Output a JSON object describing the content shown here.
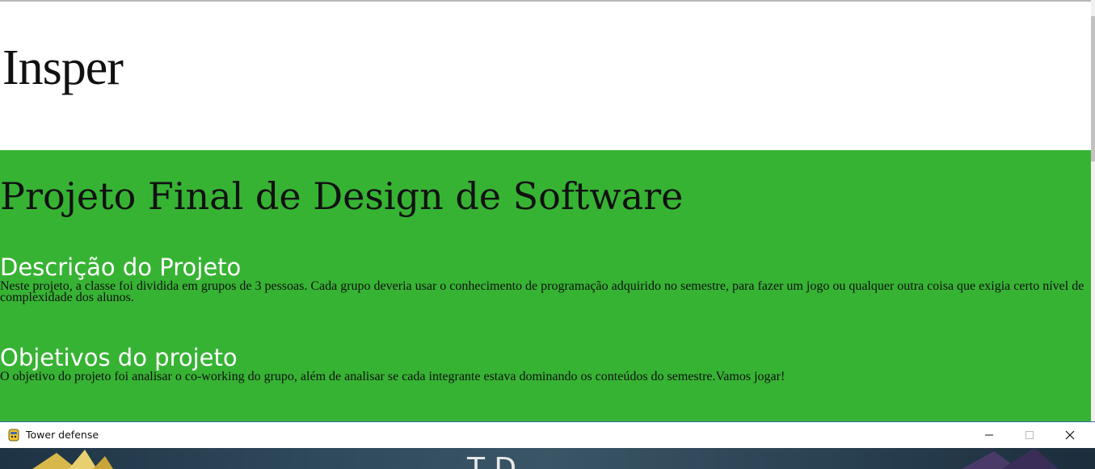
{
  "logo": {
    "text": "Insper"
  },
  "header": {
    "title": "Projeto Final de Design de Software"
  },
  "description": {
    "heading": "Descrição do Projeto",
    "text": "Neste projeto, a classe foi dividida em grupos de 3 pessoas. Cada grupo deveria usar o conhecimento de programação adquirido no semestre, para fazer um jogo ou qualquer outra coisa que exigia certo nível de complexidade dos alunos."
  },
  "objectives": {
    "heading": "Objetivos do projeto",
    "text": "O objetivo do projeto foi analisar o co-working do grupo, além de analisar se cada integrante estava dominando os conteúdos do semestre.Vamos jogar!"
  },
  "window": {
    "title": "Tower defense",
    "icon": "python-snake-icon",
    "controls": [
      "minimize-icon",
      "maximize-icon",
      "close-icon"
    ]
  },
  "game_canvas": {
    "visible_text": "T    D"
  },
  "colors": {
    "green_section": "#37b334",
    "heading_text": "#ffffff",
    "body_text": "#111111",
    "titlebar_border": "#3a6ea5"
  }
}
